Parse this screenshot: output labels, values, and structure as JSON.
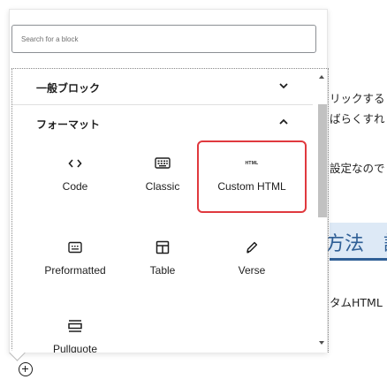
{
  "search": {
    "placeholder": "Search for a block"
  },
  "panels": [
    {
      "title": "一般ブロック",
      "state": "collapsed"
    },
    {
      "title": "フォーマット",
      "state": "expanded"
    }
  ],
  "blocks": [
    {
      "label": "Code",
      "icon": "code-icon"
    },
    {
      "label": "Classic",
      "icon": "keyboard-icon"
    },
    {
      "label": "Custom HTML",
      "icon": "html-icon",
      "icon_text": "HTML",
      "highlighted": true
    },
    {
      "label": "Preformatted",
      "icon": "preformatted-icon"
    },
    {
      "label": "Table",
      "icon": "table-icon"
    },
    {
      "label": "Verse",
      "icon": "pencil-icon"
    },
    {
      "label": "Pullquote",
      "icon": "pullquote-icon"
    }
  ],
  "background": {
    "line1": "リックする",
    "line2": "ばらくすれ",
    "line3": "設定なので",
    "heading": "方法　記",
    "line4": "タムHTML"
  },
  "colors": {
    "highlight": "#e0393e",
    "heading_bg": "#dde9f6",
    "heading_text": "#2f5f96"
  }
}
